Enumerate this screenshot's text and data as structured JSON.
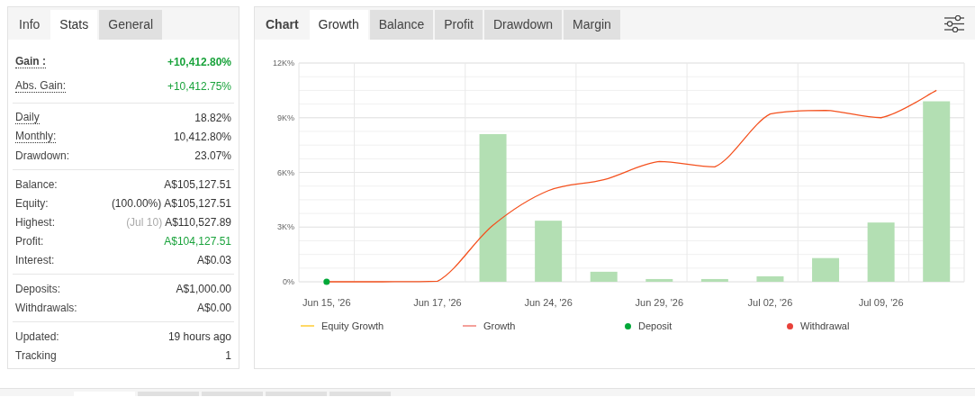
{
  "stats_panel": {
    "tabs": [
      {
        "label": "Info",
        "kind": "heading"
      },
      {
        "label": "Stats",
        "kind": "tab",
        "selected": true
      },
      {
        "label": "General",
        "kind": "tab",
        "selected": false
      }
    ],
    "groups": [
      {
        "rows": [
          {
            "label": "Gain :",
            "value": "+10,412.80%",
            "bold": true,
            "tooltip": true,
            "positive": true
          },
          {
            "label": "Abs. Gain:",
            "value": "+10,412.75%",
            "bold": false,
            "tooltip": true,
            "positive": true
          }
        ]
      },
      {
        "rows": [
          {
            "label": "Daily",
            "value": "18.82%",
            "bold": false,
            "tooltip": true,
            "positive": false
          },
          {
            "label": "Monthly:",
            "value": "10,412.80%",
            "bold": false,
            "tooltip": true,
            "positive": false
          },
          {
            "label": "Drawdown:",
            "value": "23.07%",
            "bold": false,
            "tooltip": false,
            "positive": false
          }
        ]
      },
      {
        "rows": [
          {
            "label": "Balance:",
            "value": "A$105,127.51",
            "bold": false,
            "tooltip": false,
            "positive": false
          },
          {
            "label": "Equity:",
            "note": {
              "text": "(100.00%)",
              "muted": false
            },
            "value": "A$105,127.51",
            "bold": false,
            "tooltip": false,
            "positive": false
          },
          {
            "label": "Highest:",
            "note": {
              "text": "(Jul 10)",
              "muted": true
            },
            "value": "A$110,527.89",
            "bold": false,
            "tooltip": false,
            "positive": false
          },
          {
            "label": "Profit:",
            "value": "A$104,127.51",
            "bold": false,
            "tooltip": false,
            "positive": true
          },
          {
            "label": "Interest:",
            "value": "A$0.03",
            "bold": false,
            "tooltip": false,
            "positive": false
          }
        ]
      },
      {
        "rows": [
          {
            "label": "Deposits:",
            "value": "A$1,000.00",
            "bold": false,
            "tooltip": false,
            "positive": false
          },
          {
            "label": "Withdrawals:",
            "value": "A$0.00",
            "bold": false,
            "tooltip": false,
            "positive": false
          }
        ]
      },
      {
        "rows": [
          {
            "label": "Updated:",
            "value": "19 hours ago",
            "bold": false,
            "tooltip": false,
            "positive": false
          },
          {
            "label": "Tracking",
            "value": "1",
            "bold": false,
            "tooltip": false,
            "positive": false
          }
        ]
      }
    ]
  },
  "chart_panel": {
    "tabs": [
      {
        "label": "Chart",
        "kind": "heading"
      },
      {
        "label": "Growth",
        "kind": "tab",
        "selected": true
      },
      {
        "label": "Balance",
        "kind": "tab",
        "selected": false
      },
      {
        "label": "Profit",
        "kind": "tab",
        "selected": false
      },
      {
        "label": "Drawdown",
        "kind": "tab",
        "selected": false
      },
      {
        "label": "Margin",
        "kind": "tab",
        "selected": false
      }
    ],
    "chart_data": {
      "type": "bar",
      "categories": [
        "Jun 15, '26",
        null,
        "Jun 17, '26",
        null,
        "Jun 24, '26",
        null,
        "Jun 29, '26",
        null,
        "Jul 02, '26",
        null,
        "Jul 09, '26",
        null
      ],
      "ylim": [
        0,
        12000
      ],
      "grid": true,
      "yticks": [
        {
          "value": 0,
          "label": "0%"
        },
        {
          "value": 3000,
          "label": "3K%"
        },
        {
          "value": 6000,
          "label": "6K%"
        },
        {
          "value": 9000,
          "label": "9K%"
        },
        {
          "value": 12000,
          "label": "12K%"
        }
      ],
      "series": [
        {
          "color": "#b3dfb3",
          "values": [
            null,
            null,
            null,
            8100,
            3350,
            550,
            150,
            150,
            300,
            1300,
            3250,
            9900
          ]
        },
        {
          "type": "line",
          "color": "#f4511e",
          "values": [
            0,
            0,
            30,
            3100,
            5000,
            5600,
            6600,
            6300,
            9200,
            9400,
            9000,
            10500
          ]
        },
        {
          "type": "scatter",
          "color": "#00a838",
          "values": [
            0,
            null,
            null,
            null,
            null,
            null,
            null,
            null,
            null,
            null,
            null,
            null
          ]
        }
      ]
    },
    "legend": [
      {
        "label": "Equity Growth",
        "kind": "line",
        "color": "#ffd966"
      },
      {
        "label": "Growth",
        "kind": "line",
        "color": "#f4a09a"
      },
      {
        "label": "Deposit",
        "kind": "dot",
        "color": "#00a838"
      },
      {
        "label": "Withdrawal",
        "kind": "dot",
        "color": "#e8413a"
      }
    ]
  },
  "lower_panel": {
    "tabs": [
      {
        "selected": true
      },
      {
        "selected": false
      },
      {
        "selected": false
      },
      {
        "selected": false
      },
      {
        "selected": false
      }
    ]
  }
}
